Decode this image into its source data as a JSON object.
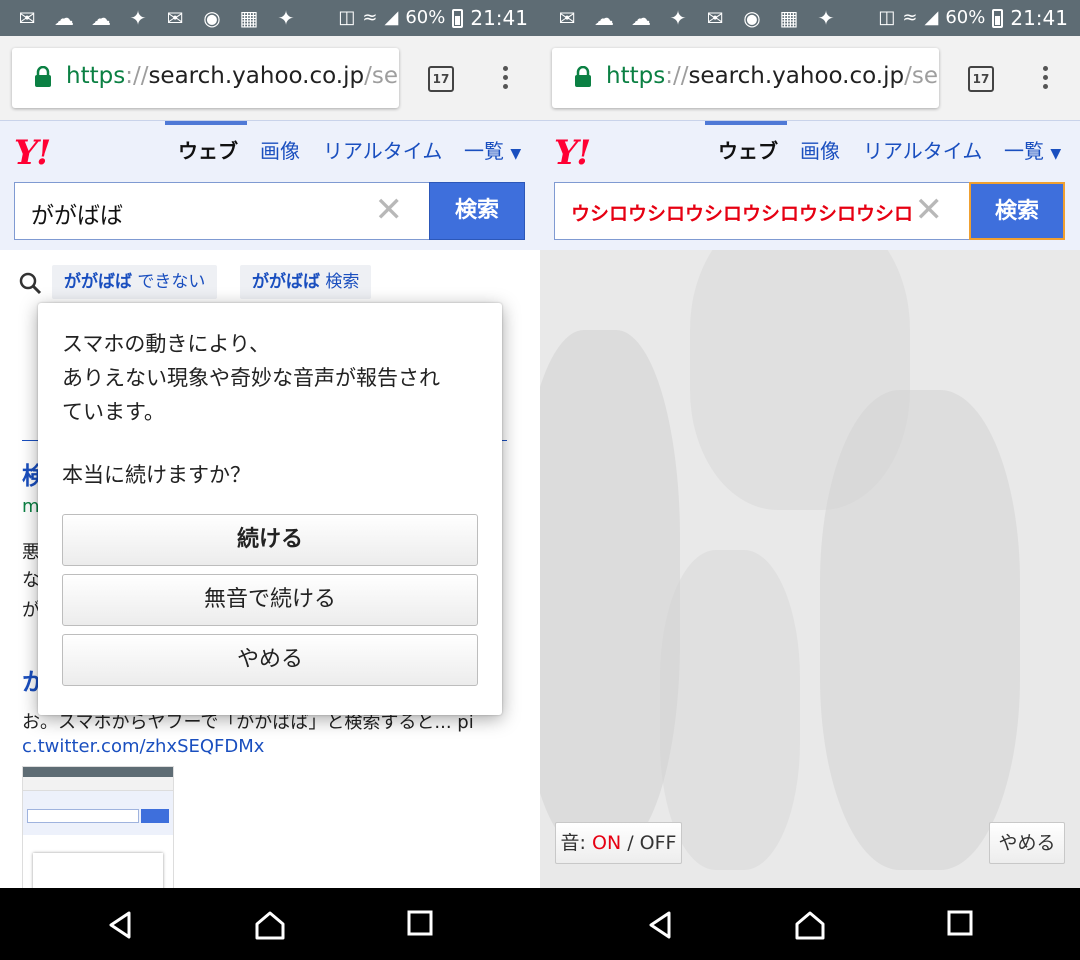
{
  "statusbar": {
    "icons": [
      "chat-icon",
      "cloud-icon",
      "cloud-icon",
      "twitter-icon",
      "mail-icon",
      "app-icon",
      "tech-news-icon",
      "twitter-icon",
      "nfc-icon",
      "wifi-icon",
      "signal-icon",
      "battery-icon"
    ],
    "battery": "60%",
    "time": "21:41"
  },
  "browser": {
    "url_scheme": "https",
    "url_sep": "://",
    "url_host": "search.yahoo.co.jp",
    "url_path": "/sea",
    "tab_count": "17"
  },
  "yahoo": {
    "logo": "Y!",
    "nav": [
      "ウェブ",
      "画像",
      "リアルタイム",
      "一覧"
    ],
    "search_button": "検索"
  },
  "left": {
    "query": "ががばば",
    "suggest_1_bold": "ががばば",
    "suggest_1_rest": " できない",
    "suggest_2_bold": "ががばば",
    "suggest_2_rest": " 検索",
    "result_snippet": "お。スマホからヤフーで「ががばば」と検索すると... pi",
    "result_link": "c.twitter.com/zhxSEQFDMx",
    "dialog": {
      "message_line1": "スマホの動きにより、",
      "message_line2": "ありえない現象や奇妙な音声が報告され",
      "message_line3": "ています。",
      "question": "本当に続けますか？",
      "btn_continue": "続ける",
      "btn_mute": "無音で続ける",
      "btn_stop": "やめる"
    }
  },
  "right": {
    "query": "ウシロウシロウシロウシロウシロウシロウシロウシロウシロウ",
    "query_color": "#e60012",
    "sound_label": "音: ",
    "sound_on": "ON",
    "sound_sep": " / ",
    "sound_off": "OFF",
    "stop_button": "やめる"
  },
  "colors": {
    "yahoo_red": "#ff0033",
    "link_blue": "#1a4fbf",
    "search_blue": "#3e6fdc",
    "secure_green": "#0b8043"
  }
}
